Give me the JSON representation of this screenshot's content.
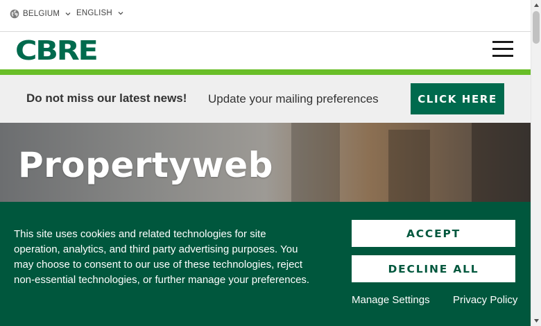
{
  "topbar": {
    "country": {
      "label": "BELGIUM",
      "icon": "globe-icon"
    },
    "language": {
      "label": "ENGLISH"
    }
  },
  "header": {
    "logo_text": "CBRE",
    "menu_icon": "hamburger-menu-icon"
  },
  "newsbar": {
    "headline": "Do not miss our latest news!",
    "text": "Update your mailing preferences",
    "button_label": "CLICK HERE"
  },
  "hero": {
    "title": "Propertyweb"
  },
  "cookie_banner": {
    "message": "This site uses cookies and related technologies for site operation, analytics, and third party advertising purposes. You may choose to consent to our use of these technologies, reject non-essential technologies, or further manage your preferences.",
    "accept_label": "ACCEPT",
    "decline_label": "DECLINE ALL",
    "manage_label": "Manage Settings",
    "privacy_label": "Privacy Policy"
  },
  "colors": {
    "brand_green": "#006a4d",
    "banner_green": "#00573d",
    "accent_lime": "#69be28",
    "news_bg": "#efefef"
  }
}
